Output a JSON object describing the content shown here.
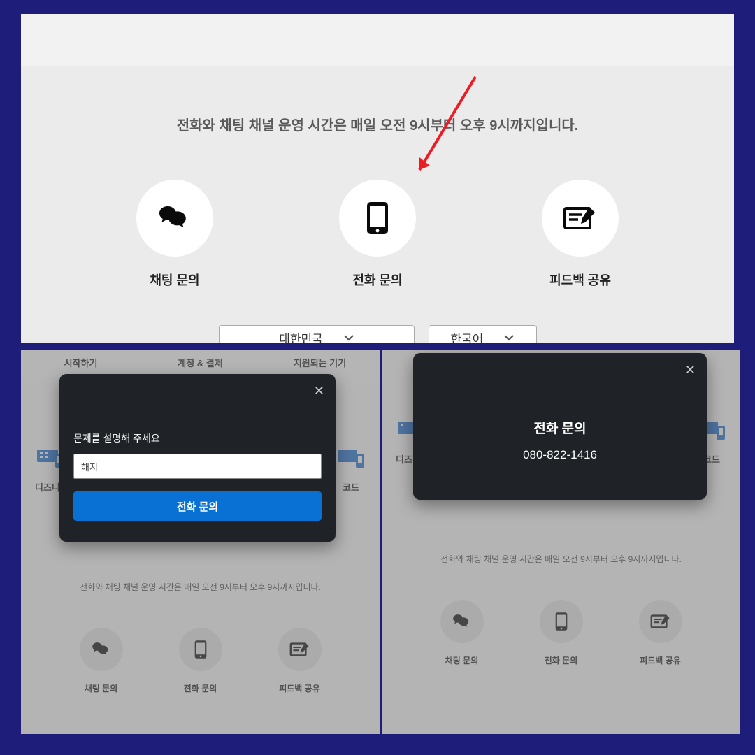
{
  "topPanel": {
    "operatingHours": "전화와 채팅 채널 운영 시간은 매일 오전 9시부터 오후 9시까지입니다.",
    "options": {
      "chat": "채팅 문의",
      "phone": "전화 문의",
      "feedback": "피드백 공유"
    },
    "country": "대한민국",
    "language": "한국어"
  },
  "bottomLeft": {
    "tabs": {
      "start": "시작하기",
      "account": "계정 & 결제",
      "devices": "지원되는 기기"
    },
    "cards": {
      "left": "디즈니+",
      "right": "코드"
    },
    "operatingHours": "전화와 채팅 채널 운영 시간은 매일 오전 9시부터 오후 9시까지입니다.",
    "options": {
      "chat": "채팅 문의",
      "phone": "전화 문의",
      "feedback": "피드백 공유"
    },
    "modal": {
      "prompt": "문제를 설명해 주세요",
      "inputValue": "해지",
      "button": "전화 문의"
    }
  },
  "bottomRight": {
    "cards": {
      "left": "디즈니+",
      "right": "코드"
    },
    "operatingHours": "전화와 채팅 채널 운영 시간은 매일 오전 9시부터 오후 9시까지입니다.",
    "options": {
      "chat": "채팅 문의",
      "phone": "전화 문의",
      "feedback": "피드백 공유"
    },
    "modal": {
      "title": "전화 문의",
      "number": "080-822-1416"
    }
  },
  "colors": {
    "bgNavy": "#1e1e7a",
    "btnBlue": "#0971d3",
    "arrow": "#ed1c24"
  }
}
